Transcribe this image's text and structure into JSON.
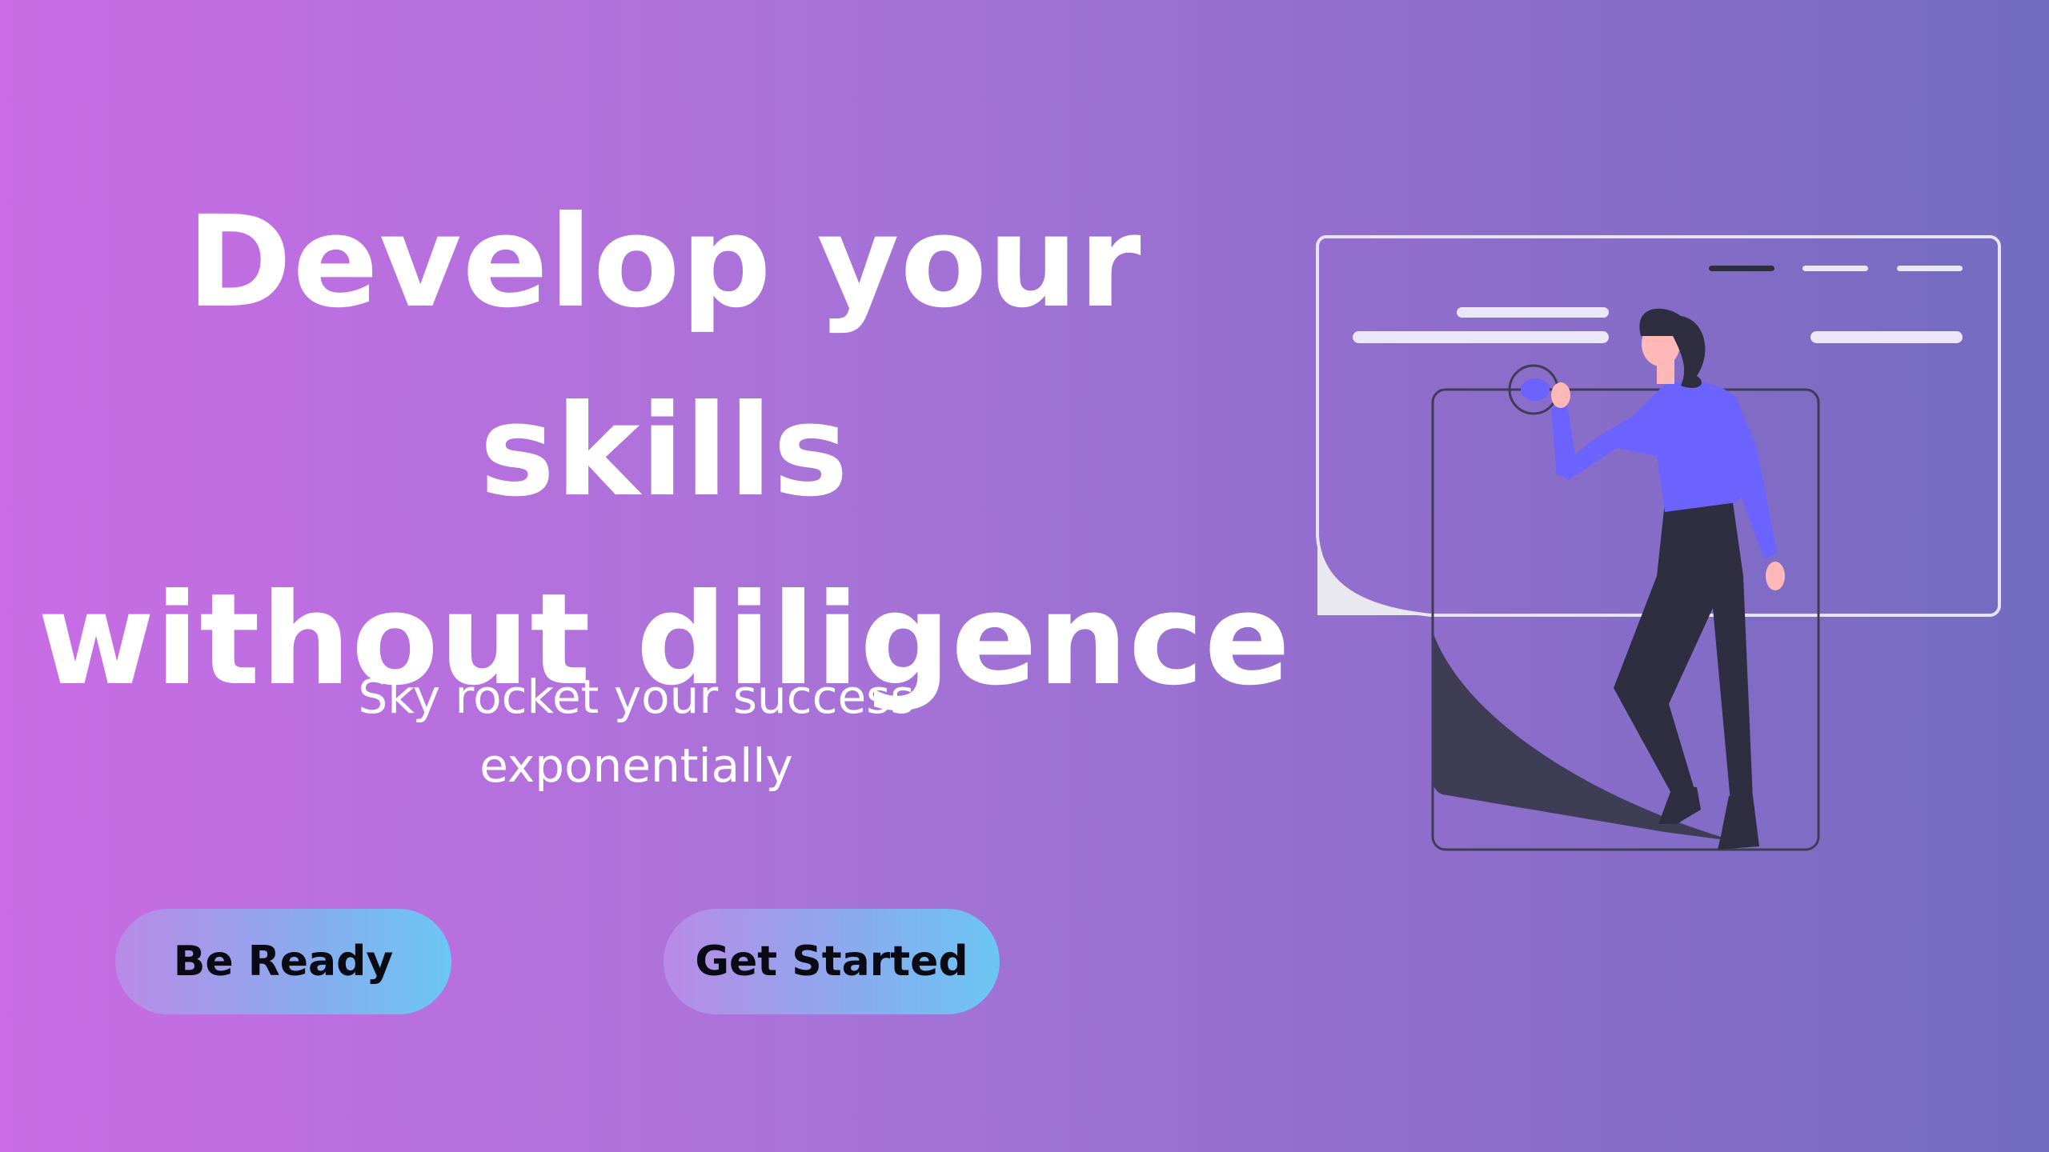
{
  "hero": {
    "title_line1": "Develop your skills",
    "title_line2": "without diligence",
    "subtitle_line1": "Sky rocket your success",
    "subtitle_line2": "exponentially"
  },
  "buttons": {
    "be_ready": "Be Ready",
    "get_started": "Get Started"
  },
  "illustration": {
    "icon": "woman-pointing-at-screen-illustration"
  },
  "colors": {
    "gradient_left": "#c96ce5",
    "gradient_right": "#736cc0",
    "button_gradient_left": "#b98ae6",
    "button_gradient_right": "#6bc6f3",
    "accent_purple": "#6c63ff",
    "dark_figure": "#2f2e41"
  }
}
